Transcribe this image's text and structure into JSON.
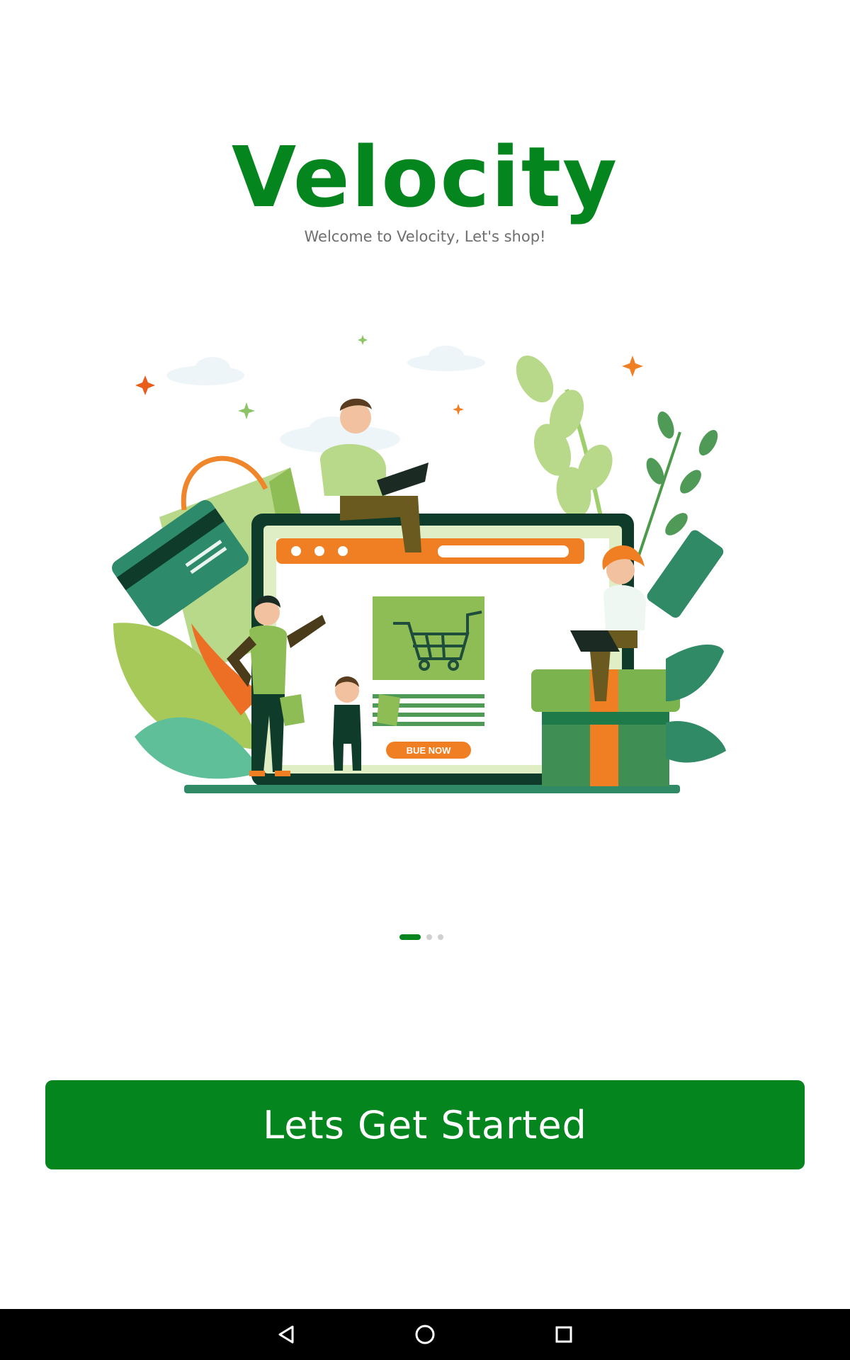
{
  "app": {
    "title": "Velocity",
    "subtitle": "Welcome to Velocity, Let's shop!"
  },
  "illustration": {
    "banner_button_label": "BUE NOW",
    "icon": "shopping-illustration"
  },
  "pager": {
    "total_pages": 3,
    "active_index": 0
  },
  "cta": {
    "label": "Lets Get Started"
  },
  "navbar": {
    "buttons": [
      "back-icon",
      "home-icon",
      "recents-icon"
    ]
  },
  "colors": {
    "brand": "#05851e",
    "subtitle": "#6f6f6f",
    "accent_orange": "#f07f24",
    "light_green": "#b8d98a",
    "dark_green": "#0f3b2a",
    "navbar": "#000000",
    "dot_inactive": "#cfcfcf"
  }
}
